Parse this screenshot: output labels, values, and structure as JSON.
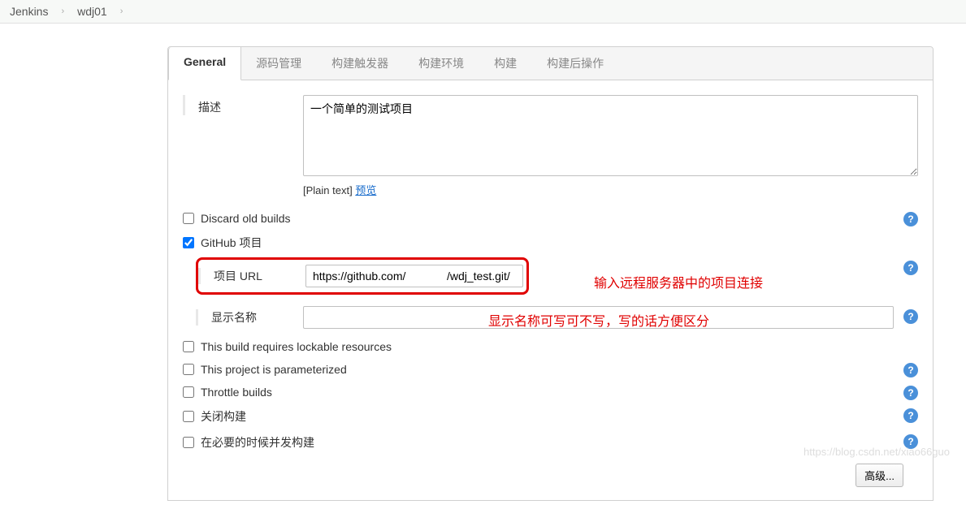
{
  "breadcrumb": {
    "item1": "Jenkins",
    "item2": "wdj01"
  },
  "tabs": {
    "general": "General",
    "scm": "源码管理",
    "triggers": "构建触发器",
    "environment": "构建环境",
    "build": "构建",
    "postbuild": "构建后操作"
  },
  "form": {
    "description_label": "描述",
    "description_value": "一个简单的测试项目",
    "plain_text": "[Plain text]",
    "preview_link": "预览",
    "discard_old_builds": "Discard old builds",
    "github_project": "GitHub 项目",
    "project_url_label": "项目 URL",
    "project_url_value": "https://github.com/             /wdj_test.git/",
    "display_name_label": "显示名称",
    "display_name_value": "",
    "lockable_resources": "This build requires lockable resources",
    "parameterized": "This project is parameterized",
    "throttle_builds": "Throttle builds",
    "disable_build": "关闭构建",
    "concurrent_build": "在必要的时候并发构建",
    "advanced_button": "高级..."
  },
  "annotations": {
    "url_hint": "输入远程服务器中的项目连接",
    "displayname_hint": "显示名称可写可不写，写的话方便区分"
  },
  "watermark": "https://blog.csdn.net/xiao66guo"
}
